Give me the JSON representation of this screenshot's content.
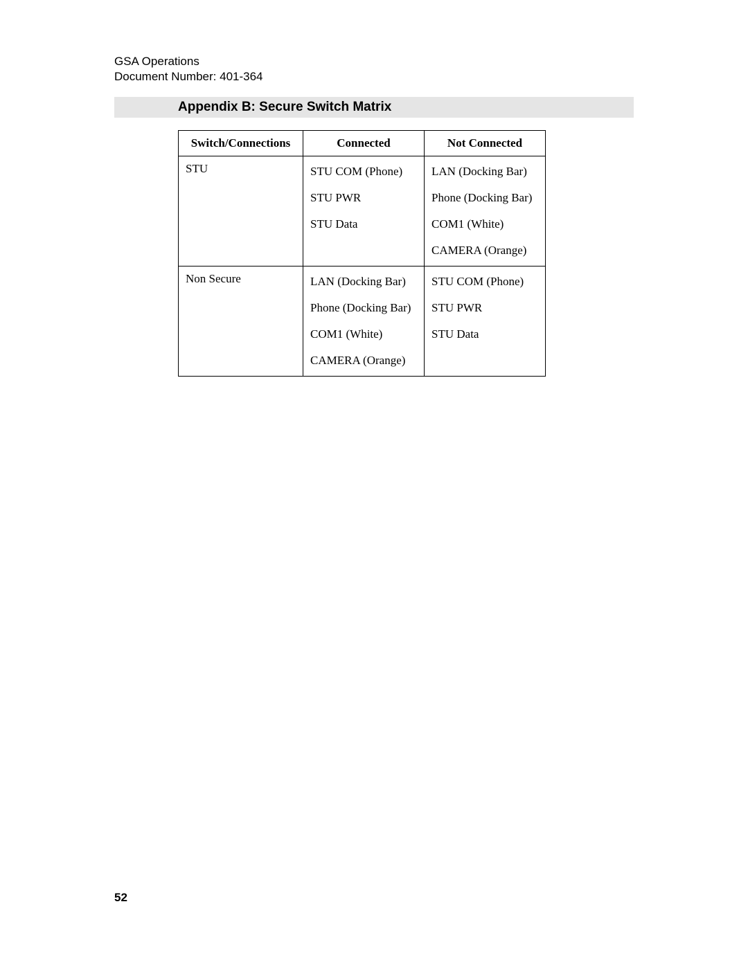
{
  "header": {
    "org": "GSA Operations",
    "doc_num": "Document Number: 401-364"
  },
  "appendix_title": "Appendix B: Secure Switch Matrix",
  "table": {
    "headers": [
      "Switch/Connections",
      "Connected",
      "Not Connected"
    ],
    "rows": [
      {
        "c0": "STU",
        "c1": [
          "STU COM (Phone)",
          "STU PWR",
          "STU Data"
        ],
        "c2": [
          "LAN (Docking Bar)",
          "Phone (Docking Bar)",
          "COM1 (White)",
          "CAMERA (Orange)"
        ]
      },
      {
        "c0": "Non Secure",
        "c1": [
          "LAN (Docking Bar)",
          "Phone (Docking Bar)",
          "COM1 (White)",
          "CAMERA (Orange)"
        ],
        "c2": [
          "STU COM (Phone)",
          "STU PWR",
          "STU Data"
        ]
      }
    ]
  },
  "page_number": "52"
}
